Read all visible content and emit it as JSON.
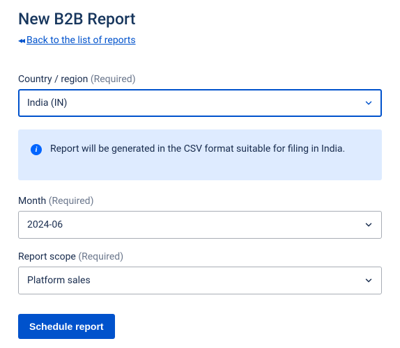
{
  "page": {
    "title": "New B2B Report",
    "back_link_text": "Back to the list of reports"
  },
  "fields": {
    "country": {
      "label": "Country / region",
      "required_text": "(Required)",
      "value": "India (IN)"
    },
    "month": {
      "label": "Month",
      "required_text": "(Required)",
      "value": "2024-06"
    },
    "scope": {
      "label": "Report scope",
      "required_text": "(Required)",
      "value": "Platform sales"
    }
  },
  "info": {
    "message": "Report will be generated in the CSV format suitable for filing in India."
  },
  "actions": {
    "submit_label": "Schedule report"
  },
  "colors": {
    "primary": "#0052cc",
    "heading": "#17365d",
    "info_bg": "#deebff"
  }
}
